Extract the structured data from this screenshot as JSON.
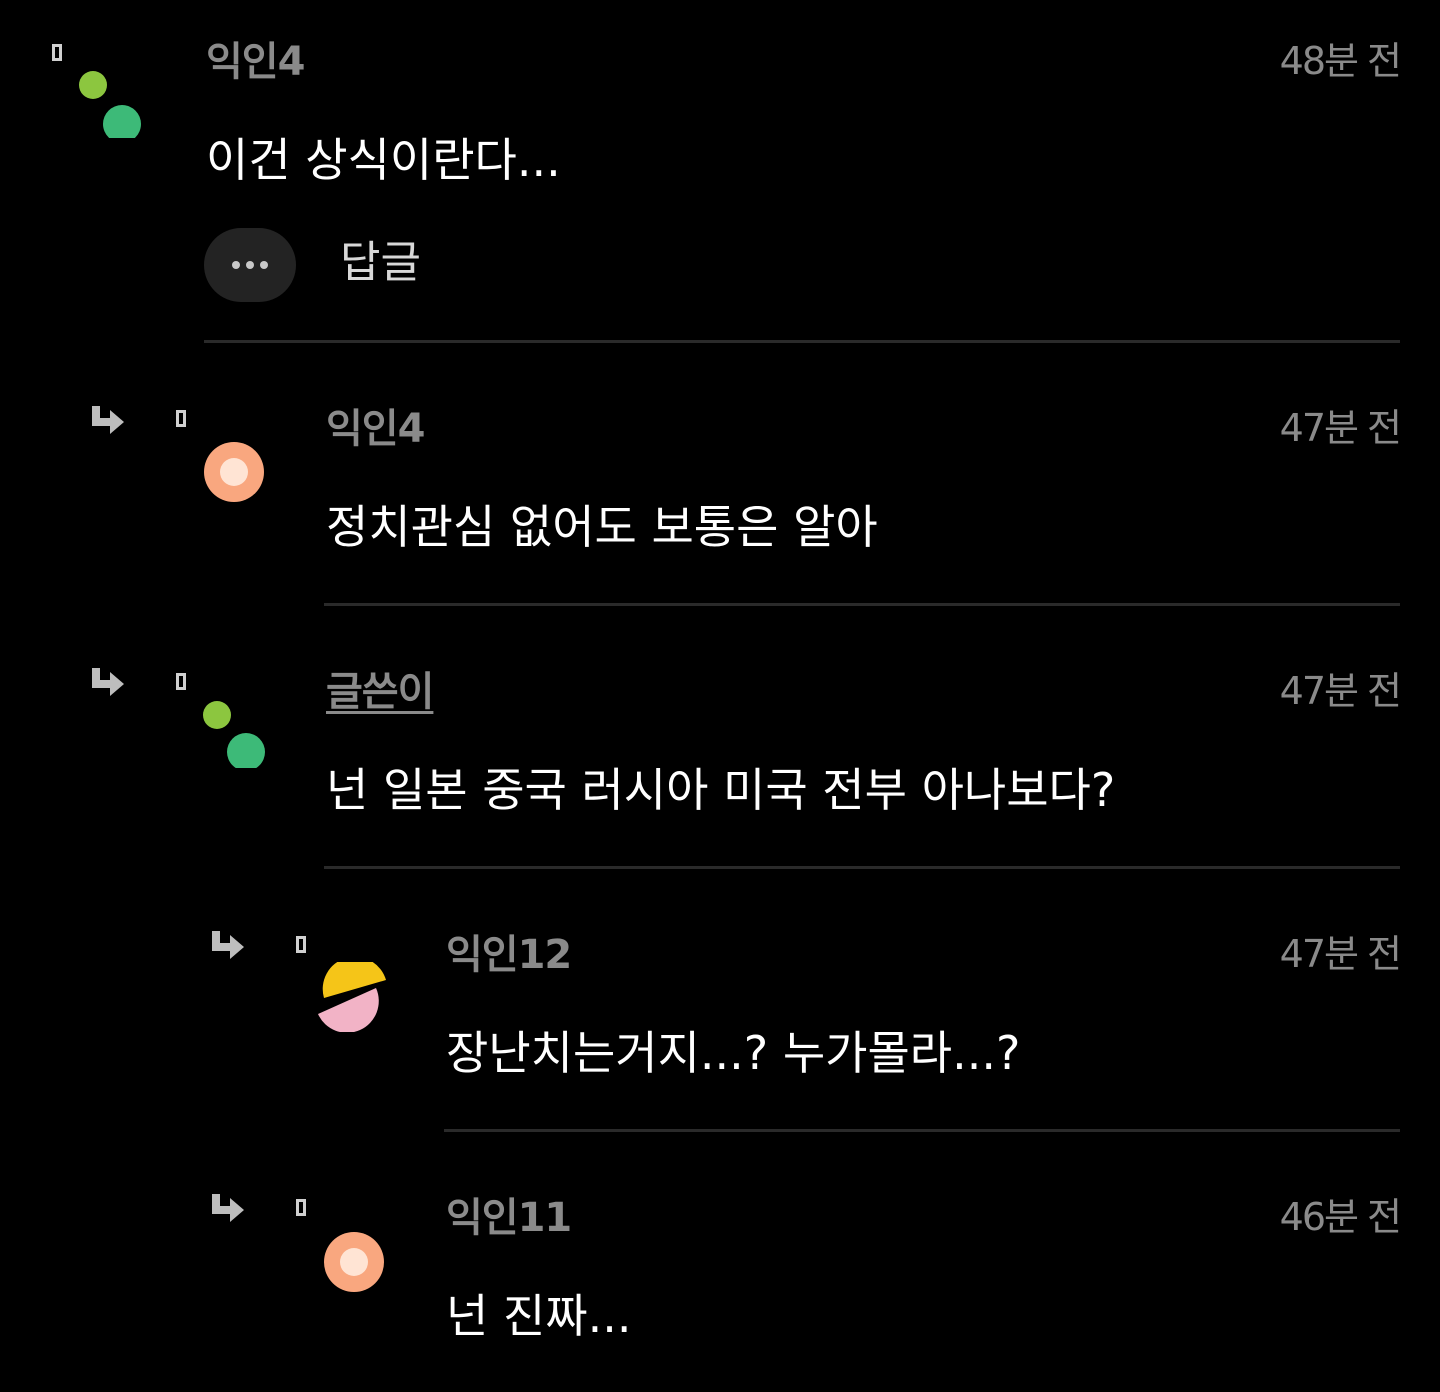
{
  "comments": [
    {
      "author": "익인4",
      "time": "48분 전",
      "text": "이건 상식이란다...",
      "reply_label": "답글",
      "avatar": "green-dots",
      "is_op": false,
      "depth": 0
    },
    {
      "author": "익인4",
      "time": "47분 전",
      "text": "정치관심 없어도 보통은 알아",
      "avatar": "orange-ring",
      "is_op": false,
      "depth": 1
    },
    {
      "author": "글쓴이",
      "time": "47분 전",
      "text": "넌 일본 중국 러시아 미국 전부 아나보다?",
      "avatar": "green-dots",
      "is_op": true,
      "depth": 1
    },
    {
      "author": "익인12",
      "time": "47분 전",
      "text": "장난치는거지...? 누가몰라...?",
      "avatar": "yellow-pink-split",
      "is_op": false,
      "depth": 2
    },
    {
      "author": "익인11",
      "time": "46분 전",
      "text": "넌 진짜...",
      "avatar": "orange-ring",
      "is_op": false,
      "depth": 2
    }
  ],
  "colors": {
    "background": "#000000",
    "author": "#8a8a8a",
    "text": "#ffffff",
    "divider": "#2a2a2a",
    "avatar_green_light": "#8cc63f",
    "avatar_green": "#3dba78",
    "avatar_orange": "#f9a77f",
    "avatar_yellow": "#f5c518",
    "avatar_pink": "#f2b3c6"
  }
}
